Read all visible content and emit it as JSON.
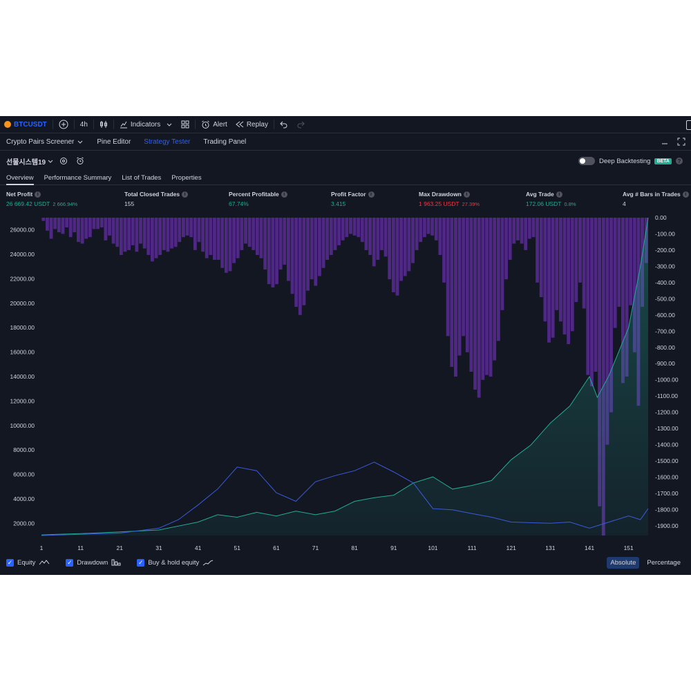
{
  "toolbar": {
    "symbol": "BTCUSDT",
    "interval": "4h",
    "indicators_label": "Indicators",
    "alert_label": "Alert",
    "replay_label": "Replay"
  },
  "panel_tabs": [
    {
      "label": "Crypto Pairs Screener",
      "active": false
    },
    {
      "label": "Pine Editor",
      "active": false
    },
    {
      "label": "Strategy Tester",
      "active": true
    },
    {
      "label": "Trading Panel",
      "active": false
    }
  ],
  "strategy": {
    "name": "선물시스템19",
    "deep_backtesting_label": "Deep Backtesting",
    "beta_label": "BETA"
  },
  "sub_tabs": [
    {
      "label": "Overview",
      "active": true
    },
    {
      "label": "Performance Summary",
      "active": false
    },
    {
      "label": "List of Trades",
      "active": false
    },
    {
      "label": "Properties",
      "active": false
    }
  ],
  "metrics": [
    {
      "label": "Net Profit",
      "value": "26 669.42 USDT",
      "sub": "2 666.94%",
      "color": "green"
    },
    {
      "label": "Total Closed Trades",
      "value": "155",
      "sub": "",
      "color": "white"
    },
    {
      "label": "Percent Profitable",
      "value": "67.74%",
      "sub": "",
      "color": "green"
    },
    {
      "label": "Profit Factor",
      "value": "3.415",
      "sub": "",
      "color": "green"
    },
    {
      "label": "Max Drawdown",
      "value": "1 963.25 USDT",
      "sub": "27.39%",
      "color": "red"
    },
    {
      "label": "Avg Trade",
      "value": "172.06 USDT",
      "sub": "0.8%",
      "color": "green"
    },
    {
      "label": "Avg # Bars in Trades",
      "value": "4",
      "sub": "",
      "color": "white"
    }
  ],
  "legend": {
    "equity_label": "Equity",
    "drawdown_label": "Drawdown",
    "buyhold_label": "Buy & hold equity",
    "absolute_label": "Absolute",
    "percentage_label": "Percentage"
  },
  "colors": {
    "equity": "#22ab94",
    "buy_hold": "#3a5bd9",
    "drawdown": "#5b2a96",
    "background": "#131722",
    "accent": "#2962ff"
  },
  "chart_data": {
    "type": "area",
    "x_ticks": [
      "1",
      "11",
      "21",
      "31",
      "41",
      "51",
      "61",
      "71",
      "81",
      "91",
      "101",
      "111",
      "121",
      "131",
      "141",
      "151"
    ],
    "left_axis_ticks": [
      "26000.00",
      "24000.00",
      "22000.00",
      "20000.00",
      "18000.00",
      "16000.00",
      "14000.00",
      "12000.00",
      "10000.00",
      "8000.00",
      "6000.00",
      "4000.00",
      "2000.00"
    ],
    "right_axis_ticks": [
      "0.00",
      "-100.00",
      "-200.00",
      "-300.00",
      "-400.00",
      "-500.00",
      "-600.00",
      "-700.00",
      "-800.00",
      "-900.00",
      "-1000.00",
      "-1100.00",
      "-1200.00",
      "-1300.00",
      "-1400.00",
      "-1500.00",
      "-1600.00",
      "-1700.00",
      "-1800.00",
      "-1900.00"
    ],
    "left_ylim": [
      1000,
      27000
    ],
    "right_ylim": [
      -1960,
      0
    ],
    "xlim": [
      1,
      156
    ],
    "series": [
      {
        "name": "Equity",
        "axis": "left",
        "points": [
          [
            1,
            1050
          ],
          [
            5,
            1100
          ],
          [
            11,
            1150
          ],
          [
            21,
            1300
          ],
          [
            31,
            1450
          ],
          [
            41,
            2100
          ],
          [
            46,
            2700
          ],
          [
            51,
            2500
          ],
          [
            56,
            2900
          ],
          [
            61,
            2600
          ],
          [
            66,
            3000
          ],
          [
            71,
            2700
          ],
          [
            76,
            3000
          ],
          [
            81,
            3800
          ],
          [
            86,
            4100
          ],
          [
            91,
            4300
          ],
          [
            96,
            5300
          ],
          [
            101,
            5800
          ],
          [
            106,
            4800
          ],
          [
            111,
            5100
          ],
          [
            116,
            5500
          ],
          [
            121,
            7200
          ],
          [
            126,
            8400
          ],
          [
            131,
            10200
          ],
          [
            136,
            11600
          ],
          [
            141,
            14000
          ],
          [
            143,
            12300
          ],
          [
            146,
            14100
          ],
          [
            151,
            18000
          ],
          [
            154,
            23000
          ],
          [
            156,
            27000
          ]
        ]
      },
      {
        "name": "Buy & hold equity",
        "axis": "left",
        "points": [
          [
            1,
            1000
          ],
          [
            11,
            1100
          ],
          [
            21,
            1200
          ],
          [
            31,
            1600
          ],
          [
            36,
            2300
          ],
          [
            41,
            3500
          ],
          [
            46,
            4800
          ],
          [
            51,
            6600
          ],
          [
            56,
            6300
          ],
          [
            61,
            4500
          ],
          [
            66,
            3800
          ],
          [
            71,
            5400
          ],
          [
            76,
            5900
          ],
          [
            81,
            6300
          ],
          [
            86,
            7000
          ],
          [
            91,
            6200
          ],
          [
            96,
            5300
          ],
          [
            101,
            3200
          ],
          [
            106,
            3100
          ],
          [
            111,
            2800
          ],
          [
            116,
            2500
          ],
          [
            121,
            2100
          ],
          [
            131,
            2000
          ],
          [
            136,
            2100
          ],
          [
            141,
            1600
          ],
          [
            146,
            2100
          ],
          [
            151,
            2600
          ],
          [
            154,
            2300
          ],
          [
            156,
            3200
          ]
        ]
      },
      {
        "name": "Drawdown",
        "axis": "right",
        "type": "bar",
        "values": [
          -20,
          -80,
          -130,
          -70,
          -90,
          -100,
          -60,
          -120,
          -90,
          -150,
          -160,
          -130,
          -120,
          -70,
          -70,
          -60,
          -140,
          -110,
          -160,
          -180,
          -230,
          -210,
          -200,
          -170,
          -210,
          -160,
          -190,
          -230,
          -270,
          -250,
          -230,
          -200,
          -210,
          -190,
          -180,
          -150,
          -120,
          -110,
          -120,
          -200,
          -150,
          -210,
          -250,
          -230,
          -260,
          -260,
          -310,
          -340,
          -330,
          -280,
          -250,
          -200,
          -160,
          -180,
          -200,
          -230,
          -250,
          -320,
          -410,
          -430,
          -410,
          -320,
          -290,
          -390,
          -470,
          -550,
          -600,
          -540,
          -450,
          -380,
          -420,
          -360,
          -310,
          -260,
          -230,
          -200,
          -170,
          -140,
          -120,
          -100,
          -110,
          -120,
          -150,
          -200,
          -230,
          -300,
          -260,
          -200,
          -240,
          -380,
          -460,
          -480,
          -390,
          -360,
          -330,
          -280,
          -200,
          -150,
          -120,
          -100,
          -110,
          -140,
          -230,
          -400,
          -730,
          -920,
          -980,
          -850,
          -730,
          -830,
          -950,
          -1060,
          -1110,
          -1000,
          -970,
          -980,
          -880,
          -760,
          -570,
          -380,
          -260,
          -160,
          -140,
          -160,
          -200,
          -130,
          -120,
          -400,
          -490,
          -640,
          -770,
          -740,
          -570,
          -640,
          -720,
          -780,
          -700,
          -520,
          -400,
          -560,
          -970,
          -1040,
          -950,
          -1780,
          -1960,
          -1400,
          -1200,
          -680,
          -550,
          -1020,
          -980,
          -540,
          -830,
          -1160,
          -550,
          -280
        ]
      }
    ]
  }
}
